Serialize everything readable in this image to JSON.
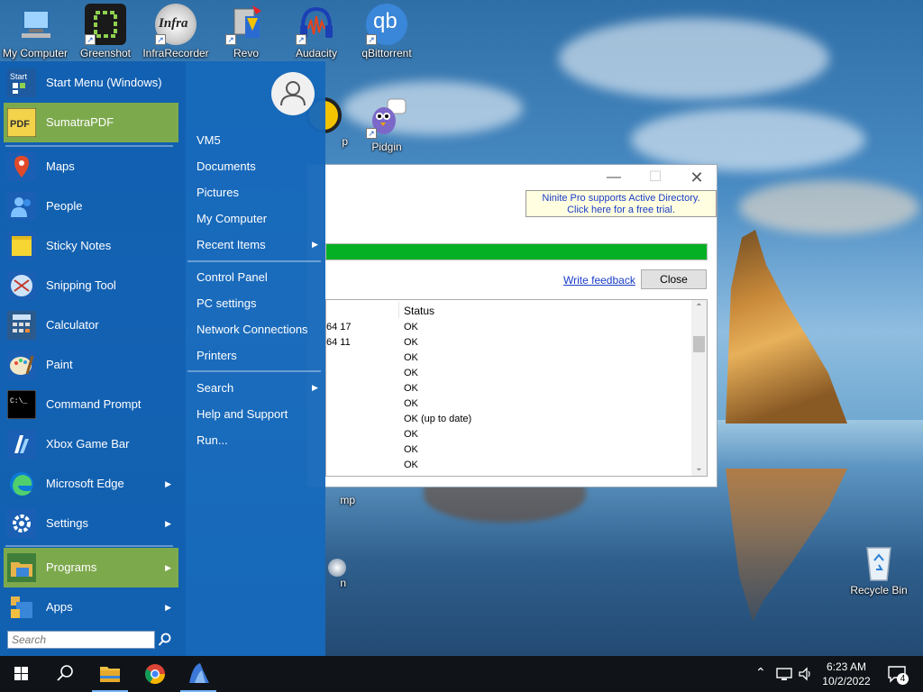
{
  "desktop": {
    "icons_top": [
      {
        "name": "my-computer",
        "label": "My Computer"
      },
      {
        "name": "greenshot",
        "label": "Greenshot"
      },
      {
        "name": "infrarecorder",
        "label": "InfraRecorder"
      },
      {
        "name": "revo",
        "label": "Revo"
      },
      {
        "name": "audacity",
        "label": "Audacity"
      },
      {
        "name": "qbittorrent",
        "label": "qBittorrent"
      }
    ],
    "pidgin_label": "Pidgin",
    "recycle_bin_label": "Recycle Bin",
    "partial_label_1": "p",
    "partial_label_2": "mp",
    "partial_label_3": "n",
    "qb_glyph": "qb",
    "infra_glyph": "Infra"
  },
  "ninite": {
    "promo_line1": "Ninite Pro supports Active Directory.",
    "promo_line2": "Click here for a free trial.",
    "progress": 1.0,
    "feedback_link": "Write feedback",
    "close_button": "Close",
    "status_header": "Status",
    "rows": [
      {
        "a": "64 17",
        "b": "OK"
      },
      {
        "a": "64 11",
        "b": "OK"
      },
      {
        "a": "",
        "b": "OK"
      },
      {
        "a": "",
        "b": "OK"
      },
      {
        "a": "",
        "b": "OK"
      },
      {
        "a": "",
        "b": "OK"
      },
      {
        "a": "",
        "b": "OK (up to date)"
      },
      {
        "a": "",
        "b": "OK"
      },
      {
        "a": "",
        "b": "OK"
      },
      {
        "a": "",
        "b": "OK"
      }
    ]
  },
  "start_menu": {
    "apps": [
      {
        "label": "Start Menu (Windows)",
        "icon": "start-menu-icon",
        "arrow": ""
      },
      {
        "label": "SumatraPDF",
        "icon": "pdf-icon",
        "arrow": ""
      },
      {
        "label": "Maps",
        "icon": "map-pin-icon",
        "arrow": ""
      },
      {
        "label": "People",
        "icon": "people-icon",
        "arrow": ""
      },
      {
        "label": "Sticky Notes",
        "icon": "sticky-note-icon",
        "arrow": ""
      },
      {
        "label": "Snipping Tool",
        "icon": "scissors-icon",
        "arrow": ""
      },
      {
        "label": "Calculator",
        "icon": "calculator-icon",
        "arrow": ""
      },
      {
        "label": "Paint",
        "icon": "palette-icon",
        "arrow": ""
      },
      {
        "label": "Command Prompt",
        "icon": "terminal-icon",
        "arrow": ""
      },
      {
        "label": "Xbox Game Bar",
        "icon": "xbox-icon",
        "arrow": ""
      },
      {
        "label": "Microsoft Edge",
        "icon": "edge-icon",
        "arrow": "▶"
      },
      {
        "label": "Settings",
        "icon": "gear-icon",
        "arrow": "▶"
      },
      {
        "label": "Programs",
        "icon": "programs-icon",
        "arrow": "▶"
      },
      {
        "label": "Apps",
        "icon": "apps-icon",
        "arrow": "▶"
      }
    ],
    "start_icon_text": "Start",
    "pdf_icon_text": "PDF",
    "cmd_icon_text": "C:\\_",
    "search_placeholder": "Search",
    "right_items": [
      {
        "label": "VM5",
        "arrow": ""
      },
      {
        "label": "Documents",
        "arrow": ""
      },
      {
        "label": "Pictures",
        "arrow": ""
      },
      {
        "label": "My Computer",
        "arrow": ""
      },
      {
        "label": "Recent Items",
        "arrow": "▶"
      },
      {
        "label": "Control Panel",
        "arrow": ""
      },
      {
        "label": "PC settings",
        "arrow": ""
      },
      {
        "label": "Network Connections",
        "arrow": ""
      },
      {
        "label": "Printers",
        "arrow": ""
      },
      {
        "label": "Search",
        "arrow": "▶"
      },
      {
        "label": "Help and Support",
        "arrow": ""
      },
      {
        "label": "Run...",
        "arrow": ""
      }
    ]
  },
  "taskbar": {
    "time": "6:23 AM",
    "date": "10/2/2022",
    "notification_count": "4"
  },
  "colors": {
    "accent_green": "#7da94d",
    "start_blue": "#1668ba",
    "progress_green": "#06b025"
  }
}
